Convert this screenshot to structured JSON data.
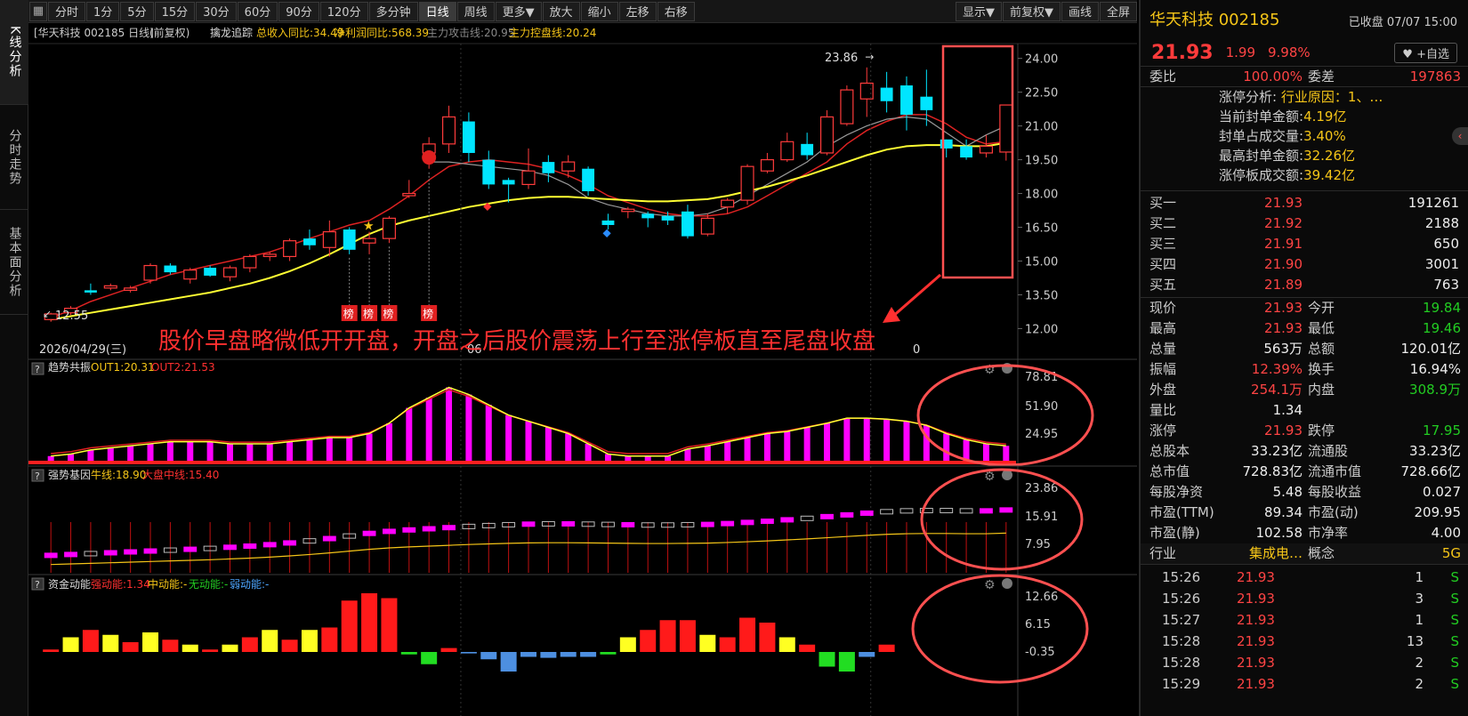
{
  "vtabs": [
    "K线分析",
    "分时走势",
    "基本面分析"
  ],
  "toolbar": {
    "items": [
      "分时",
      "1分",
      "5分",
      "15分",
      "30分",
      "60分",
      "90分",
      "120分",
      "多分钟",
      "日线",
      "周线",
      "更多▼",
      "放大",
      "缩小",
      "左移",
      "右移"
    ],
    "active": "日线",
    "right_items": [
      "显示▼",
      "前复权▼",
      "画线",
      "全屏"
    ]
  },
  "main_header": {
    "title": "[华天科技 002185 日线]",
    "fq": "(前复权)",
    "indicator": "擒龙追踪",
    "metrics": [
      "总收入同比:34.49",
      "净利润同比:568.39",
      "主力攻击线:20.95",
      "主力控盘线:20.24"
    ]
  },
  "price_axis": [
    "24.00",
    "22.50",
    "21.00",
    "19.50",
    "18.00",
    "16.50",
    "15.00",
    "13.50",
    "12.00"
  ],
  "annotations": {
    "high_label": "23.86",
    "low_label": "12.55",
    "date_label": "2026/04/29(三)",
    "month_label_1": "06",
    "month_label_2": "0",
    "bang": "榜",
    "caption": "股价早盘略微低开开盘，开盘之后股价震荡上行至涨停板直至尾盘收盘"
  },
  "sub1": {
    "name": "趋势共振",
    "out1": "OUT1:20.31",
    "out2": "OUT2:21.53",
    "axis": [
      "78.81",
      "51.90",
      "24.95"
    ]
  },
  "sub2": {
    "name": "强势基因",
    "l1": "牛线:18.90",
    "l2": "大盘中线:15.40",
    "axis": [
      "23.86",
      "15.91",
      "7.95"
    ]
  },
  "sub3": {
    "name": "资金动能",
    "l1": "强动能:1.34",
    "l2": "中动能:-",
    "l3": "无动能:-",
    "l4": "弱动能:-",
    "axis": [
      "12.66",
      "6.15",
      "-0.35"
    ]
  },
  "chart_data": {
    "type": "candlestick",
    "candles": [
      [
        12.4,
        12.65,
        12.3,
        12.7
      ],
      [
        12.7,
        12.9,
        12.6,
        13.0
      ],
      [
        13.7,
        13.6,
        13.5,
        14.0
      ],
      [
        13.8,
        13.9,
        13.7,
        14.0
      ],
      [
        13.7,
        13.8,
        13.6,
        13.9
      ],
      [
        14.15,
        14.8,
        14.0,
        14.9
      ],
      [
        14.8,
        14.5,
        14.4,
        14.9
      ],
      [
        14.2,
        14.6,
        14.0,
        14.7
      ],
      [
        14.7,
        14.35,
        14.3,
        14.8
      ],
      [
        14.3,
        14.7,
        14.1,
        14.8
      ],
      [
        14.7,
        15.2,
        14.5,
        15.3
      ],
      [
        15.2,
        15.3,
        15.0,
        15.4
      ],
      [
        15.2,
        15.9,
        15.0,
        16.0
      ],
      [
        16.0,
        15.7,
        15.5,
        16.4
      ],
      [
        15.6,
        16.3,
        15.2,
        16.8
      ],
      [
        16.4,
        15.5,
        15.3,
        16.5
      ],
      [
        15.8,
        16.0,
        15.3,
        16.3
      ],
      [
        16.0,
        16.9,
        15.8,
        17.0
      ],
      [
        17.9,
        18.0,
        17.8,
        18.6
      ],
      [
        19.8,
        20.2,
        19.1,
        20.5
      ],
      [
        20.2,
        21.4,
        19.8,
        21.9
      ],
      [
        21.2,
        19.8,
        19.4,
        21.6
      ],
      [
        19.5,
        18.4,
        18.2,
        19.9
      ],
      [
        18.6,
        18.4,
        17.6,
        18.7
      ],
      [
        18.4,
        19.0,
        18.2,
        20.0
      ],
      [
        19.4,
        18.9,
        18.5,
        19.7
      ],
      [
        19.0,
        19.4,
        18.7,
        19.7
      ],
      [
        19.1,
        18.1,
        17.9,
        19.2
      ],
      [
        16.8,
        16.6,
        16.4,
        17.1
      ],
      [
        17.2,
        17.3,
        16.9,
        17.4
      ],
      [
        17.1,
        16.9,
        16.5,
        17.2
      ],
      [
        17.0,
        16.8,
        16.6,
        17.2
      ],
      [
        17.2,
        16.1,
        16.0,
        17.5
      ],
      [
        16.2,
        16.9,
        16.1,
        17.1
      ],
      [
        17.4,
        17.7,
        17.1,
        17.8
      ],
      [
        17.7,
        19.2,
        17.5,
        19.3
      ],
      [
        19.0,
        19.5,
        18.9,
        19.8
      ],
      [
        19.5,
        20.3,
        19.4,
        20.7
      ],
      [
        20.2,
        19.7,
        19.5,
        20.7
      ],
      [
        19.8,
        21.4,
        19.7,
        21.7
      ],
      [
        21.1,
        22.6,
        21.0,
        22.8
      ],
      [
        22.2,
        22.9,
        21.4,
        23.6
      ],
      [
        22.7,
        22.1,
        21.6,
        23.4
      ],
      [
        22.8,
        21.5,
        20.8,
        23.2
      ],
      [
        22.3,
        21.7,
        21.0,
        23.5
      ],
      [
        20.4,
        20.0,
        19.6,
        20.4
      ],
      [
        20.1,
        19.6,
        19.5,
        20.4
      ],
      [
        19.8,
        20.1,
        19.6,
        20.6
      ],
      [
        19.84,
        21.93,
        19.46,
        21.93
      ]
    ],
    "ma_yellow": [
      12.4,
      12.55,
      12.7,
      12.85,
      13.0,
      13.15,
      13.3,
      13.45,
      13.6,
      13.8,
      14.0,
      14.25,
      14.55,
      14.9,
      15.3,
      15.75,
      16.2,
      16.55,
      16.8,
      17.0,
      17.2,
      17.4,
      17.55,
      17.7,
      17.8,
      17.85,
      17.85,
      17.8,
      17.75,
      17.7,
      17.65,
      17.65,
      17.7,
      17.75,
      17.9,
      18.1,
      18.3,
      18.55,
      18.8,
      19.1,
      19.4,
      19.7,
      19.95,
      20.1,
      20.15,
      20.15,
      20.1,
      20.1,
      20.25
    ],
    "ma_red": [
      12.5,
      12.8,
      13.2,
      13.5,
      13.8,
      14.1,
      14.4,
      14.6,
      14.8,
      15.0,
      15.2,
      15.4,
      15.7,
      16.0,
      16.3,
      16.6,
      16.8,
      17.3,
      17.9,
      18.6,
      19.2,
      19.4,
      19.5,
      19.4,
      19.3,
      19.1,
      18.8,
      18.4,
      17.9,
      17.6,
      17.3,
      17.1,
      17.0,
      17.0,
      17.1,
      17.4,
      17.9,
      18.4,
      18.9,
      19.4,
      20.2,
      20.8,
      21.2,
      21.5,
      21.5,
      21.1,
      20.5,
      20.2,
      20.3
    ],
    "ma_gray": [
      19.4,
      19.4,
      19.3,
      19.2,
      19.1,
      19.0,
      18.8,
      18.4,
      17.8,
      17.5,
      17.3,
      17.1,
      17.0,
      17.0,
      17.1,
      17.4,
      17.9,
      18.4,
      18.9,
      19.4,
      20.1,
      20.6,
      21.0,
      21.3,
      21.4,
      21.3,
      20.7,
      20.1,
      20.6,
      21.0
    ],
    "sub1_bars": [
      8,
      10,
      14,
      16,
      18,
      20,
      22,
      22,
      22,
      20,
      20,
      20,
      22,
      24,
      26,
      26,
      30,
      40,
      55,
      65,
      75,
      68,
      58,
      48,
      42,
      36,
      30,
      20,
      10,
      8,
      8,
      8,
      15,
      18,
      22,
      26,
      30,
      32,
      36,
      40,
      45,
      45,
      44,
      42,
      38,
      30,
      24,
      20,
      18,
      16
    ],
    "sub3_bars": [
      0.5,
      3.0,
      4.5,
      3.5,
      2.0,
      4.0,
      2.5,
      1.5,
      0.5,
      1.5,
      3.0,
      4.5,
      2.5,
      4.5,
      5.0,
      10.5,
      12.0,
      11.0,
      -0.5,
      -2.5,
      0.8,
      -0.3,
      -1.5,
      -4.0,
      -1.0,
      -1.2,
      -1.0,
      -1.0,
      -0.5,
      3.0,
      4.5,
      6.5,
      6.5,
      3.5,
      3.0,
      7.0,
      6.0,
      3.0,
      1.5,
      -3.0,
      -4.0,
      -1.0,
      1.5
    ]
  },
  "quote": {
    "name": "华天科技 002185",
    "status": "已收盘 07/07 15:00",
    "price": "21.93",
    "change": "1.99",
    "pct": "9.98%",
    "follow": "+自选",
    "weibi_label": "委比",
    "weibi": "100.00%",
    "weicha_label": "委差",
    "weicha": "197863",
    "limit_reason_label": "涨停分析:",
    "limit_reason": "行业原因：1、…",
    "limit_items": [
      {
        "label": "当前封单金额:",
        "value": "4.19亿"
      },
      {
        "label": "封单占成交量:",
        "value": "3.40%"
      },
      {
        "label": "最高封单金额:",
        "value": "32.26亿"
      },
      {
        "label": "涨停板成交额:",
        "value": "39.42亿"
      }
    ],
    "bids": [
      {
        "label": "买一",
        "price": "21.93",
        "qty": "191261"
      },
      {
        "label": "买二",
        "price": "21.92",
        "qty": "2188"
      },
      {
        "label": "买三",
        "price": "21.91",
        "qty": "650"
      },
      {
        "label": "买四",
        "price": "21.90",
        "qty": "3001"
      },
      {
        "label": "买五",
        "price": "21.89",
        "qty": "763"
      }
    ],
    "stats": [
      [
        "现价",
        "21.93",
        "red",
        "今开",
        "19.84",
        "green"
      ],
      [
        "最高",
        "21.93",
        "red",
        "最低",
        "19.46",
        "green"
      ],
      [
        "总量",
        "563万",
        "white",
        "总额",
        "120.01亿",
        "white"
      ],
      [
        "振幅",
        "12.39%",
        "red",
        "换手",
        "16.94%",
        "white"
      ],
      [
        "外盘",
        "254.1万",
        "red",
        "内盘",
        "308.9万",
        "green"
      ],
      [
        "量比",
        "1.34",
        "white",
        "",
        "",
        ""
      ],
      [
        "涨停",
        "21.93",
        "red",
        "跌停",
        "17.95",
        "green"
      ],
      [
        "总股本",
        "33.23亿",
        "white",
        "流通股",
        "33.23亿",
        "white"
      ],
      [
        "总市值",
        "728.83亿",
        "white",
        "流通市值",
        "728.66亿",
        "white"
      ],
      [
        "每股净资",
        "5.48",
        "white",
        "每股收益",
        "0.027",
        "white"
      ],
      [
        "市盈(TTM)",
        "89.34",
        "white",
        "市盈(动)",
        "209.95",
        "white"
      ],
      [
        "市盈(静)",
        "102.58",
        "white",
        "市净率",
        "4.00",
        "white"
      ],
      [
        "行业",
        "集成电…",
        "yellow",
        "概念",
        "5G",
        "yellow"
      ]
    ],
    "ticks": [
      {
        "time": "15:26",
        "price": "21.93",
        "vol": "1",
        "side": "S"
      },
      {
        "time": "15:26",
        "price": "21.93",
        "vol": "3",
        "side": "S"
      },
      {
        "time": "15:27",
        "price": "21.93",
        "vol": "1",
        "side": "S"
      },
      {
        "time": "15:28",
        "price": "21.93",
        "vol": "13",
        "side": "S"
      },
      {
        "time": "15:28",
        "price": "21.93",
        "vol": "2",
        "side": "S"
      },
      {
        "time": "15:29",
        "price": "21.93",
        "vol": "2",
        "side": "S"
      }
    ]
  }
}
